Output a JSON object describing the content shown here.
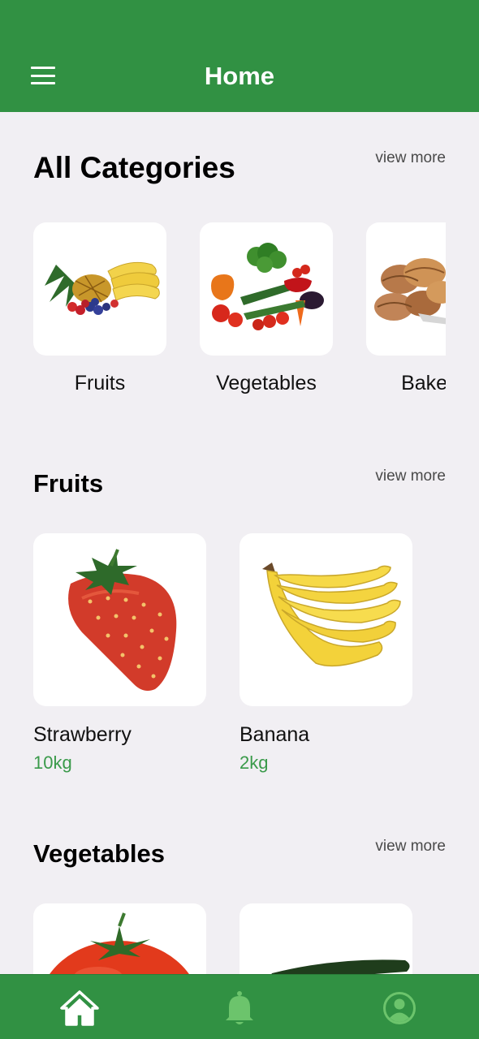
{
  "app_bar": {
    "title": "Home",
    "menu_icon": "hamburger-menu-icon"
  },
  "colors": {
    "primary": "#319143",
    "background": "#f1eff3",
    "weight_text": "#3a9a4a"
  },
  "sections": {
    "categories": {
      "title": "All Categories",
      "view_more": "view more",
      "items": [
        {
          "label": "Fruits"
        },
        {
          "label": "Vegetables"
        },
        {
          "label": "Bakery"
        }
      ]
    },
    "fruits": {
      "title": "Fruits",
      "view_more": "view more",
      "items": [
        {
          "name": "Strawberry",
          "weight": "10kg"
        },
        {
          "name": "Banana",
          "weight": "2kg"
        }
      ]
    },
    "vegetables": {
      "title": "Vegetables",
      "view_more": "view more",
      "items": [
        {
          "name": "Tomato"
        },
        {
          "name": "Cucumber"
        }
      ]
    }
  },
  "bottom_nav": {
    "items": [
      {
        "icon": "home-icon",
        "active": true
      },
      {
        "icon": "bell-icon",
        "active": false
      },
      {
        "icon": "profile-icon",
        "active": false
      }
    ]
  }
}
